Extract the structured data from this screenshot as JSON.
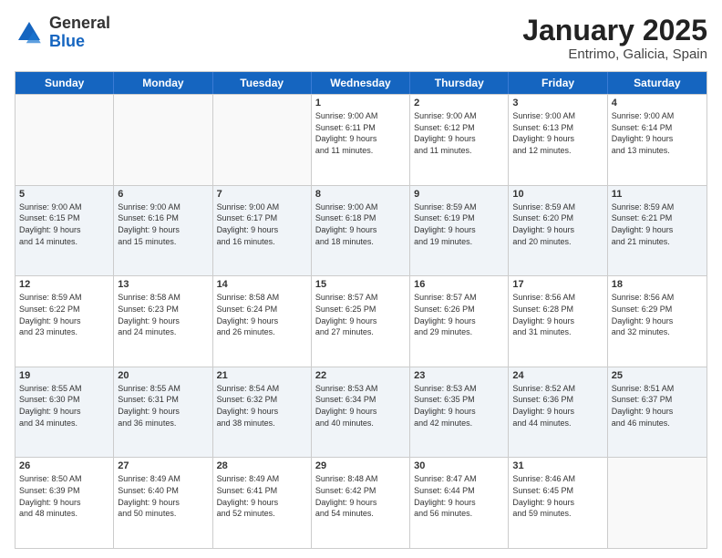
{
  "header": {
    "logo_general": "General",
    "logo_blue": "Blue",
    "title": "January 2025",
    "subtitle": "Entrimo, Galicia, Spain"
  },
  "days": [
    "Sunday",
    "Monday",
    "Tuesday",
    "Wednesday",
    "Thursday",
    "Friday",
    "Saturday"
  ],
  "weeks": [
    [
      {
        "day": "",
        "info": ""
      },
      {
        "day": "",
        "info": ""
      },
      {
        "day": "",
        "info": ""
      },
      {
        "day": "1",
        "info": "Sunrise: 9:00 AM\nSunset: 6:11 PM\nDaylight: 9 hours\nand 11 minutes."
      },
      {
        "day": "2",
        "info": "Sunrise: 9:00 AM\nSunset: 6:12 PM\nDaylight: 9 hours\nand 11 minutes."
      },
      {
        "day": "3",
        "info": "Sunrise: 9:00 AM\nSunset: 6:13 PM\nDaylight: 9 hours\nand 12 minutes."
      },
      {
        "day": "4",
        "info": "Sunrise: 9:00 AM\nSunset: 6:14 PM\nDaylight: 9 hours\nand 13 minutes."
      }
    ],
    [
      {
        "day": "5",
        "info": "Sunrise: 9:00 AM\nSunset: 6:15 PM\nDaylight: 9 hours\nand 14 minutes."
      },
      {
        "day": "6",
        "info": "Sunrise: 9:00 AM\nSunset: 6:16 PM\nDaylight: 9 hours\nand 15 minutes."
      },
      {
        "day": "7",
        "info": "Sunrise: 9:00 AM\nSunset: 6:17 PM\nDaylight: 9 hours\nand 16 minutes."
      },
      {
        "day": "8",
        "info": "Sunrise: 9:00 AM\nSunset: 6:18 PM\nDaylight: 9 hours\nand 18 minutes."
      },
      {
        "day": "9",
        "info": "Sunrise: 8:59 AM\nSunset: 6:19 PM\nDaylight: 9 hours\nand 19 minutes."
      },
      {
        "day": "10",
        "info": "Sunrise: 8:59 AM\nSunset: 6:20 PM\nDaylight: 9 hours\nand 20 minutes."
      },
      {
        "day": "11",
        "info": "Sunrise: 8:59 AM\nSunset: 6:21 PM\nDaylight: 9 hours\nand 21 minutes."
      }
    ],
    [
      {
        "day": "12",
        "info": "Sunrise: 8:59 AM\nSunset: 6:22 PM\nDaylight: 9 hours\nand 23 minutes."
      },
      {
        "day": "13",
        "info": "Sunrise: 8:58 AM\nSunset: 6:23 PM\nDaylight: 9 hours\nand 24 minutes."
      },
      {
        "day": "14",
        "info": "Sunrise: 8:58 AM\nSunset: 6:24 PM\nDaylight: 9 hours\nand 26 minutes."
      },
      {
        "day": "15",
        "info": "Sunrise: 8:57 AM\nSunset: 6:25 PM\nDaylight: 9 hours\nand 27 minutes."
      },
      {
        "day": "16",
        "info": "Sunrise: 8:57 AM\nSunset: 6:26 PM\nDaylight: 9 hours\nand 29 minutes."
      },
      {
        "day": "17",
        "info": "Sunrise: 8:56 AM\nSunset: 6:28 PM\nDaylight: 9 hours\nand 31 minutes."
      },
      {
        "day": "18",
        "info": "Sunrise: 8:56 AM\nSunset: 6:29 PM\nDaylight: 9 hours\nand 32 minutes."
      }
    ],
    [
      {
        "day": "19",
        "info": "Sunrise: 8:55 AM\nSunset: 6:30 PM\nDaylight: 9 hours\nand 34 minutes."
      },
      {
        "day": "20",
        "info": "Sunrise: 8:55 AM\nSunset: 6:31 PM\nDaylight: 9 hours\nand 36 minutes."
      },
      {
        "day": "21",
        "info": "Sunrise: 8:54 AM\nSunset: 6:32 PM\nDaylight: 9 hours\nand 38 minutes."
      },
      {
        "day": "22",
        "info": "Sunrise: 8:53 AM\nSunset: 6:34 PM\nDaylight: 9 hours\nand 40 minutes."
      },
      {
        "day": "23",
        "info": "Sunrise: 8:53 AM\nSunset: 6:35 PM\nDaylight: 9 hours\nand 42 minutes."
      },
      {
        "day": "24",
        "info": "Sunrise: 8:52 AM\nSunset: 6:36 PM\nDaylight: 9 hours\nand 44 minutes."
      },
      {
        "day": "25",
        "info": "Sunrise: 8:51 AM\nSunset: 6:37 PM\nDaylight: 9 hours\nand 46 minutes."
      }
    ],
    [
      {
        "day": "26",
        "info": "Sunrise: 8:50 AM\nSunset: 6:39 PM\nDaylight: 9 hours\nand 48 minutes."
      },
      {
        "day": "27",
        "info": "Sunrise: 8:49 AM\nSunset: 6:40 PM\nDaylight: 9 hours\nand 50 minutes."
      },
      {
        "day": "28",
        "info": "Sunrise: 8:49 AM\nSunset: 6:41 PM\nDaylight: 9 hours\nand 52 minutes."
      },
      {
        "day": "29",
        "info": "Sunrise: 8:48 AM\nSunset: 6:42 PM\nDaylight: 9 hours\nand 54 minutes."
      },
      {
        "day": "30",
        "info": "Sunrise: 8:47 AM\nSunset: 6:44 PM\nDaylight: 9 hours\nand 56 minutes."
      },
      {
        "day": "31",
        "info": "Sunrise: 8:46 AM\nSunset: 6:45 PM\nDaylight: 9 hours\nand 59 minutes."
      },
      {
        "day": "",
        "info": ""
      }
    ]
  ]
}
